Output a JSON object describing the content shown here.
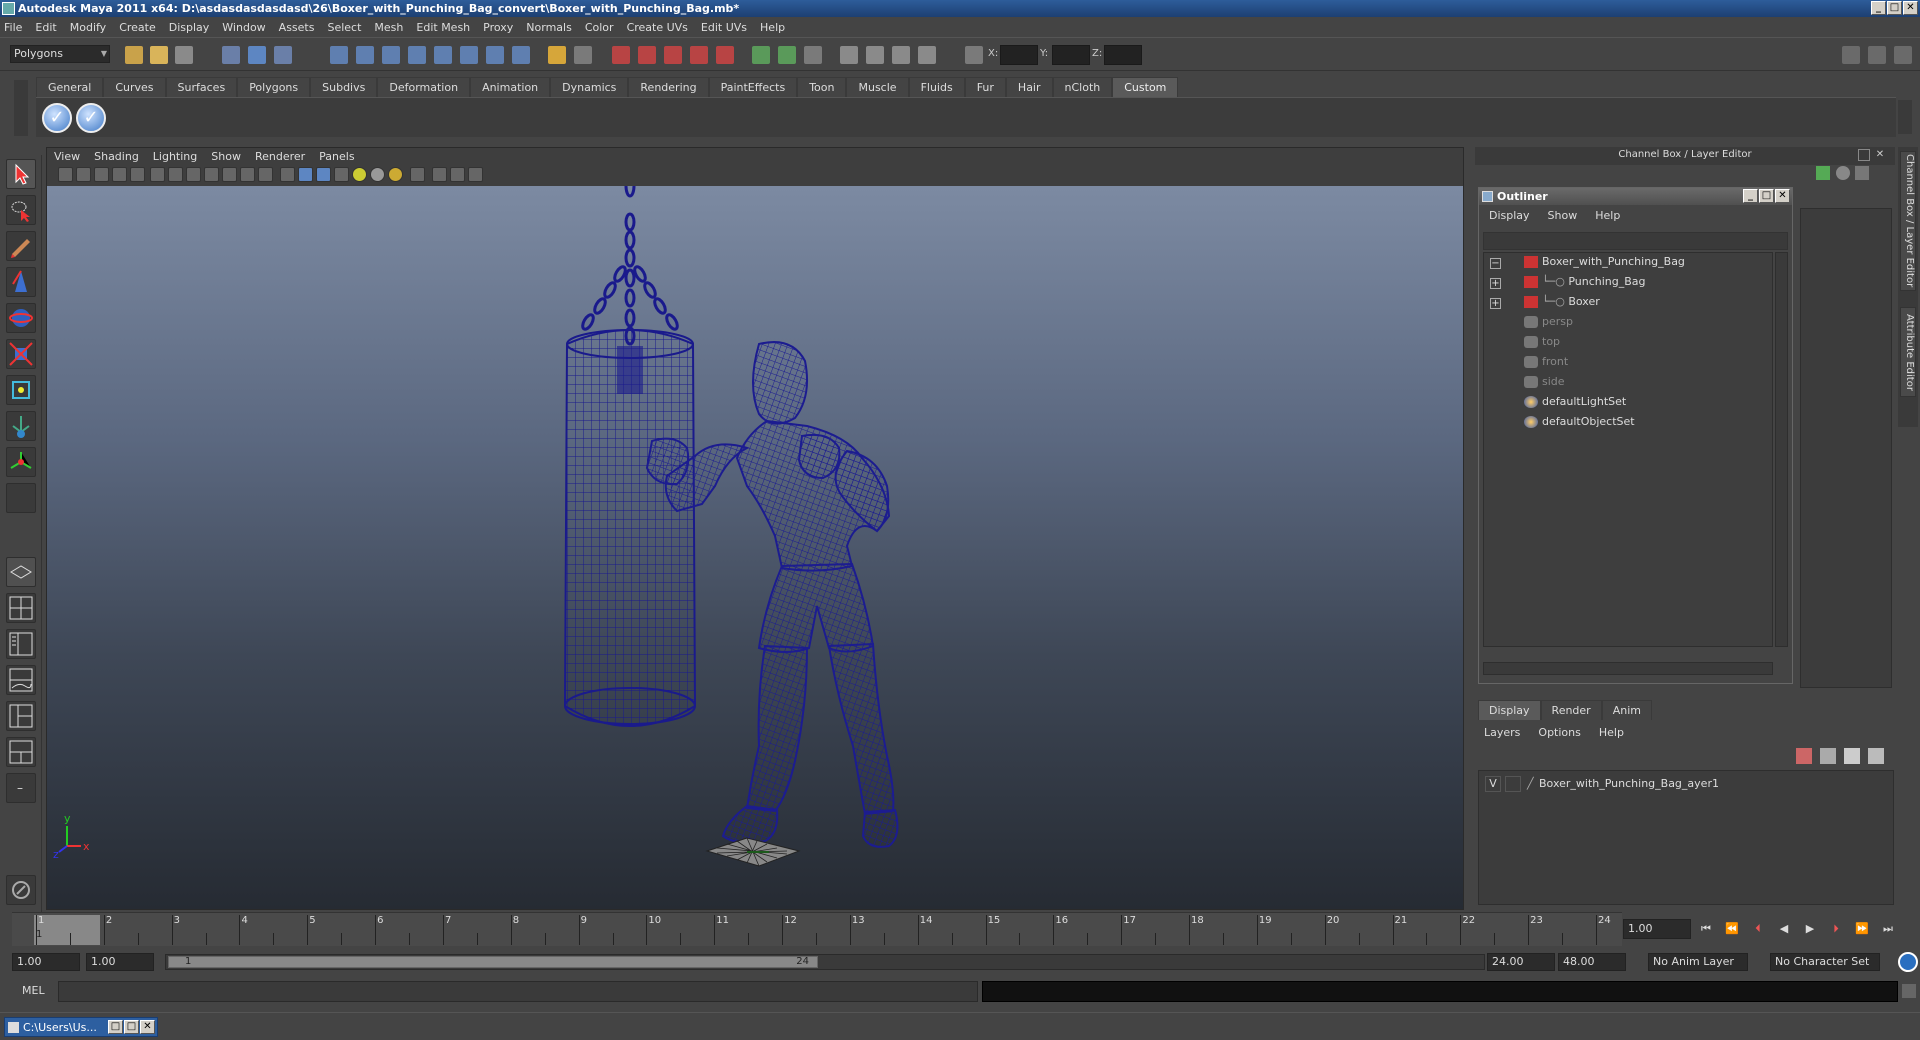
{
  "window": {
    "title": "Autodesk Maya 2011 x64: D:\\asdasdasdasdasd\\26\\Boxer_with_Punching_Bag_convert\\Boxer_with_Punching_Bag.mb*"
  },
  "menubar": [
    "File",
    "Edit",
    "Modify",
    "Create",
    "Display",
    "Window",
    "Assets",
    "Select",
    "Mesh",
    "Edit Mesh",
    "Proxy",
    "Normals",
    "Color",
    "Create UVs",
    "Edit UVs",
    "Help"
  ],
  "statusline": {
    "menuset": "Polygons",
    "x_label": "X:",
    "y_label": "Y:",
    "z_label": "Z:"
  },
  "shelf": {
    "tabs": [
      "General",
      "Curves",
      "Surfaces",
      "Polygons",
      "Subdivs",
      "Deformation",
      "Animation",
      "Dynamics",
      "Rendering",
      "PaintEffects",
      "Toon",
      "Muscle",
      "Fluids",
      "Fur",
      "Hair",
      "nCloth",
      "Custom"
    ],
    "active_tab": "Custom",
    "buttons": [
      "✓",
      "✓"
    ]
  },
  "viewport": {
    "menus": [
      "View",
      "Shading",
      "Lighting",
      "Show",
      "Renderer",
      "Panels"
    ],
    "axis_y": "y",
    "axis_x": "x",
    "axis_z": "z",
    "colors": {
      "wire": "#1a1a8c",
      "bg_top": "#7c8aa2",
      "bg_bottom": "#262b33"
    }
  },
  "channelbox": {
    "title": "Channel Box / Layer Editor",
    "side_tabs": [
      "Channel Box / Layer Editor",
      "Attribute Editor"
    ]
  },
  "outliner": {
    "title": "Outliner",
    "menus": [
      "Display",
      "Show",
      "Help"
    ],
    "items": [
      {
        "label": "Boxer_with_Punching_Bag",
        "expander": "−",
        "dim": false,
        "indent": 0
      },
      {
        "label": "Punching_Bag",
        "expander": "+",
        "dim": false,
        "indent": 1
      },
      {
        "label": "Boxer",
        "expander": "+",
        "dim": false,
        "indent": 1
      },
      {
        "label": "persp",
        "expander": "",
        "dim": true,
        "indent": 0
      },
      {
        "label": "top",
        "expander": "",
        "dim": true,
        "indent": 0
      },
      {
        "label": "front",
        "expander": "",
        "dim": true,
        "indent": 0
      },
      {
        "label": "side",
        "expander": "",
        "dim": true,
        "indent": 0
      },
      {
        "label": "defaultLightSet",
        "expander": "",
        "dim": false,
        "indent": 0
      },
      {
        "label": "defaultObjectSet",
        "expander": "",
        "dim": false,
        "indent": 0
      }
    ]
  },
  "layer_editor": {
    "tabs": [
      "Display",
      "Render",
      "Anim"
    ],
    "active_tab": "Display",
    "menus": [
      "Layers",
      "Options",
      "Help"
    ],
    "layers": [
      {
        "visible": "V",
        "name": "Boxer_with_Punching_Bag_ayer1"
      }
    ]
  },
  "timeline": {
    "ticks": [
      "1",
      "2",
      "3",
      "4",
      "5",
      "6",
      "7",
      "8",
      "9",
      "10",
      "11",
      "12",
      "13",
      "14",
      "15",
      "16",
      "17",
      "18",
      "19",
      "20",
      "21",
      "22",
      "23",
      "24"
    ],
    "current_frame_marker": "1",
    "current_time": "1.00"
  },
  "range": {
    "start_time": "1.00",
    "playback_start": "1.00",
    "range_start": "1",
    "range_end": "24",
    "playback_end": "24.00",
    "end_time": "48.00",
    "anim_layer": "No Anim Layer",
    "character_set": "No Character Set"
  },
  "command_line": {
    "label": "MEL"
  },
  "taskbar": {
    "item": "C:\\Users\\Us..."
  }
}
